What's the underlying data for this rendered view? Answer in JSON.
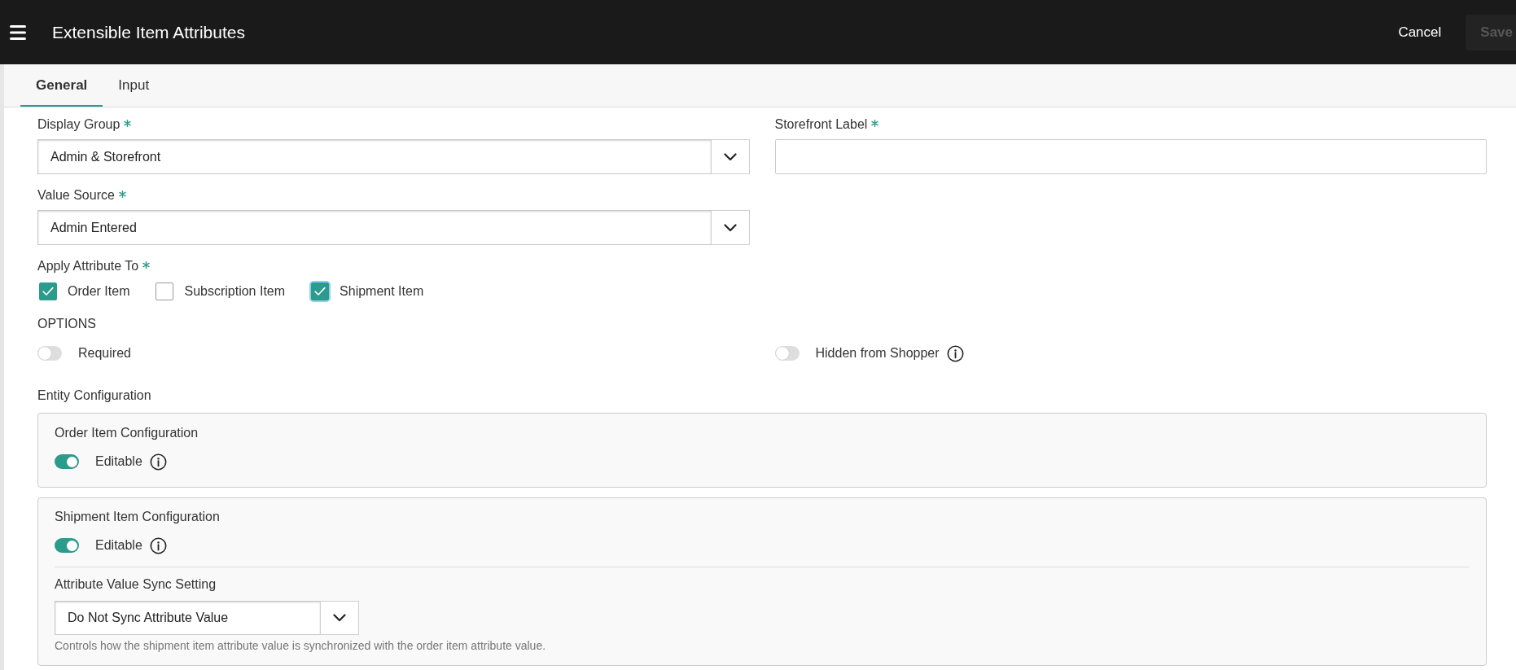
{
  "header": {
    "title": "Extensible Item Attributes",
    "actions": [
      {
        "label": "Cancel",
        "disabled": false
      },
      {
        "label": "Save",
        "disabled": true
      }
    ]
  },
  "tabs": [
    {
      "label": "General",
      "selected": true
    },
    {
      "label": "Input",
      "selected": false
    }
  ],
  "fields": [
    {
      "kind": "select",
      "label": "Display Group",
      "required": true,
      "value": "Admin & Storefront"
    },
    {
      "kind": "text",
      "label": "Storefront Label",
      "required": true
    },
    {
      "kind": "select",
      "label": "Value Source",
      "required": true,
      "value": "Admin Entered"
    }
  ],
  "apply_to": {
    "label": "Apply Attribute To",
    "required": true,
    "options": [
      {
        "label": "Order Item",
        "checked": true,
        "focused": false
      },
      {
        "label": "Subscription Item",
        "checked": false,
        "focused": false
      },
      {
        "label": "Shipment Item",
        "checked": true,
        "focused": true
      }
    ]
  },
  "options": {
    "title": "OPTIONS",
    "toggles": [
      {
        "label": "Required",
        "on": false
      },
      {
        "label": "Hidden from Shopper",
        "on": false,
        "info": true
      }
    ]
  },
  "entity_configuration": {
    "title": "Entity Configuration",
    "cards": [
      {
        "title": "Order Item Configuration",
        "toggles": [
          {
            "label": "Editable",
            "on": true,
            "info": true
          }
        ]
      },
      {
        "title": "Shipment Item Configuration",
        "toggles": [
          {
            "label": "Editable",
            "on": true,
            "info": true
          }
        ],
        "sync_setting": {
          "label": "Attribute Value Sync Setting",
          "value": "Do Not Sync Attribute Value",
          "help": "Controls how the shipment item attribute value is synchronized with the order item attribute value."
        }
      }
    ]
  }
}
